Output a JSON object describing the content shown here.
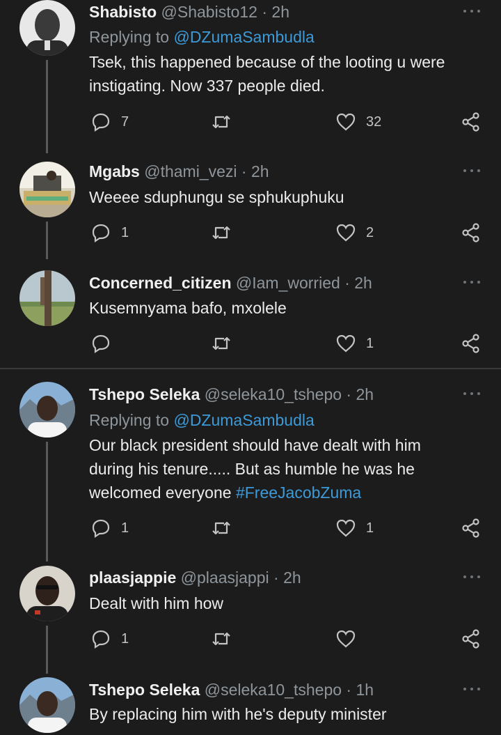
{
  "colors": {
    "background": "#1c1c1c",
    "mention_link": "#3d9ad8",
    "secondary_text": "#8e969c",
    "thread_line": "#5a5a5a"
  },
  "icons": {
    "reply": "reply-icon",
    "retweet": "retweet-icon",
    "like": "heart-icon",
    "share": "share-icon",
    "more": "more-icon"
  },
  "tweets": [
    {
      "name": "Shabisto",
      "handle": "@Shabisto12",
      "separator": "·",
      "time": "2h",
      "replying_prefix": "Replying to",
      "replying_to": "@DZumaSambudla",
      "text_lines": [
        "Tsek, this happened because of the looting u were",
        "instigating. Now 337 people died."
      ],
      "reply_count": "7",
      "retweet_count": "",
      "like_count": "32"
    },
    {
      "name": "Mgabs",
      "handle": "@thami_vezi",
      "separator": "·",
      "time": "2h",
      "text_lines": [
        "Weeee sduphungu se sphukuphuku"
      ],
      "reply_count": "1",
      "retweet_count": "",
      "like_count": "2"
    },
    {
      "name": "Concerned_citizen",
      "handle": "@Iam_worried",
      "separator": "·",
      "time": "2h",
      "text_lines": [
        "Kusemnyama bafo, mxolele"
      ],
      "reply_count": "",
      "retweet_count": "",
      "like_count": "1"
    },
    {
      "name": "Tshepo Seleka",
      "handle": "@seleka10_tshepo",
      "separator": "·",
      "time": "2h",
      "replying_prefix": "Replying to",
      "replying_to": "@DZumaSambudla",
      "text_lines": [
        "Our black president should have dealt with him",
        "during his tenure..... But as humble he was he"
      ],
      "text_last_prefix": "welcomed everyone ",
      "hashtag": "#FreeJacobZuma",
      "reply_count": "1",
      "retweet_count": "",
      "like_count": "1"
    },
    {
      "name": "plaasjappie",
      "handle": "@plaasjappi",
      "separator": "·",
      "time": "2h",
      "text_lines": [
        "Dealt with him how"
      ],
      "reply_count": "1",
      "retweet_count": "",
      "like_count": ""
    },
    {
      "name": "Tshepo Seleka",
      "handle": "@seleka10_tshepo",
      "separator": "·",
      "time": "1h",
      "text_lines": [
        "By replacing him with he's deputy minister"
      ]
    }
  ]
}
